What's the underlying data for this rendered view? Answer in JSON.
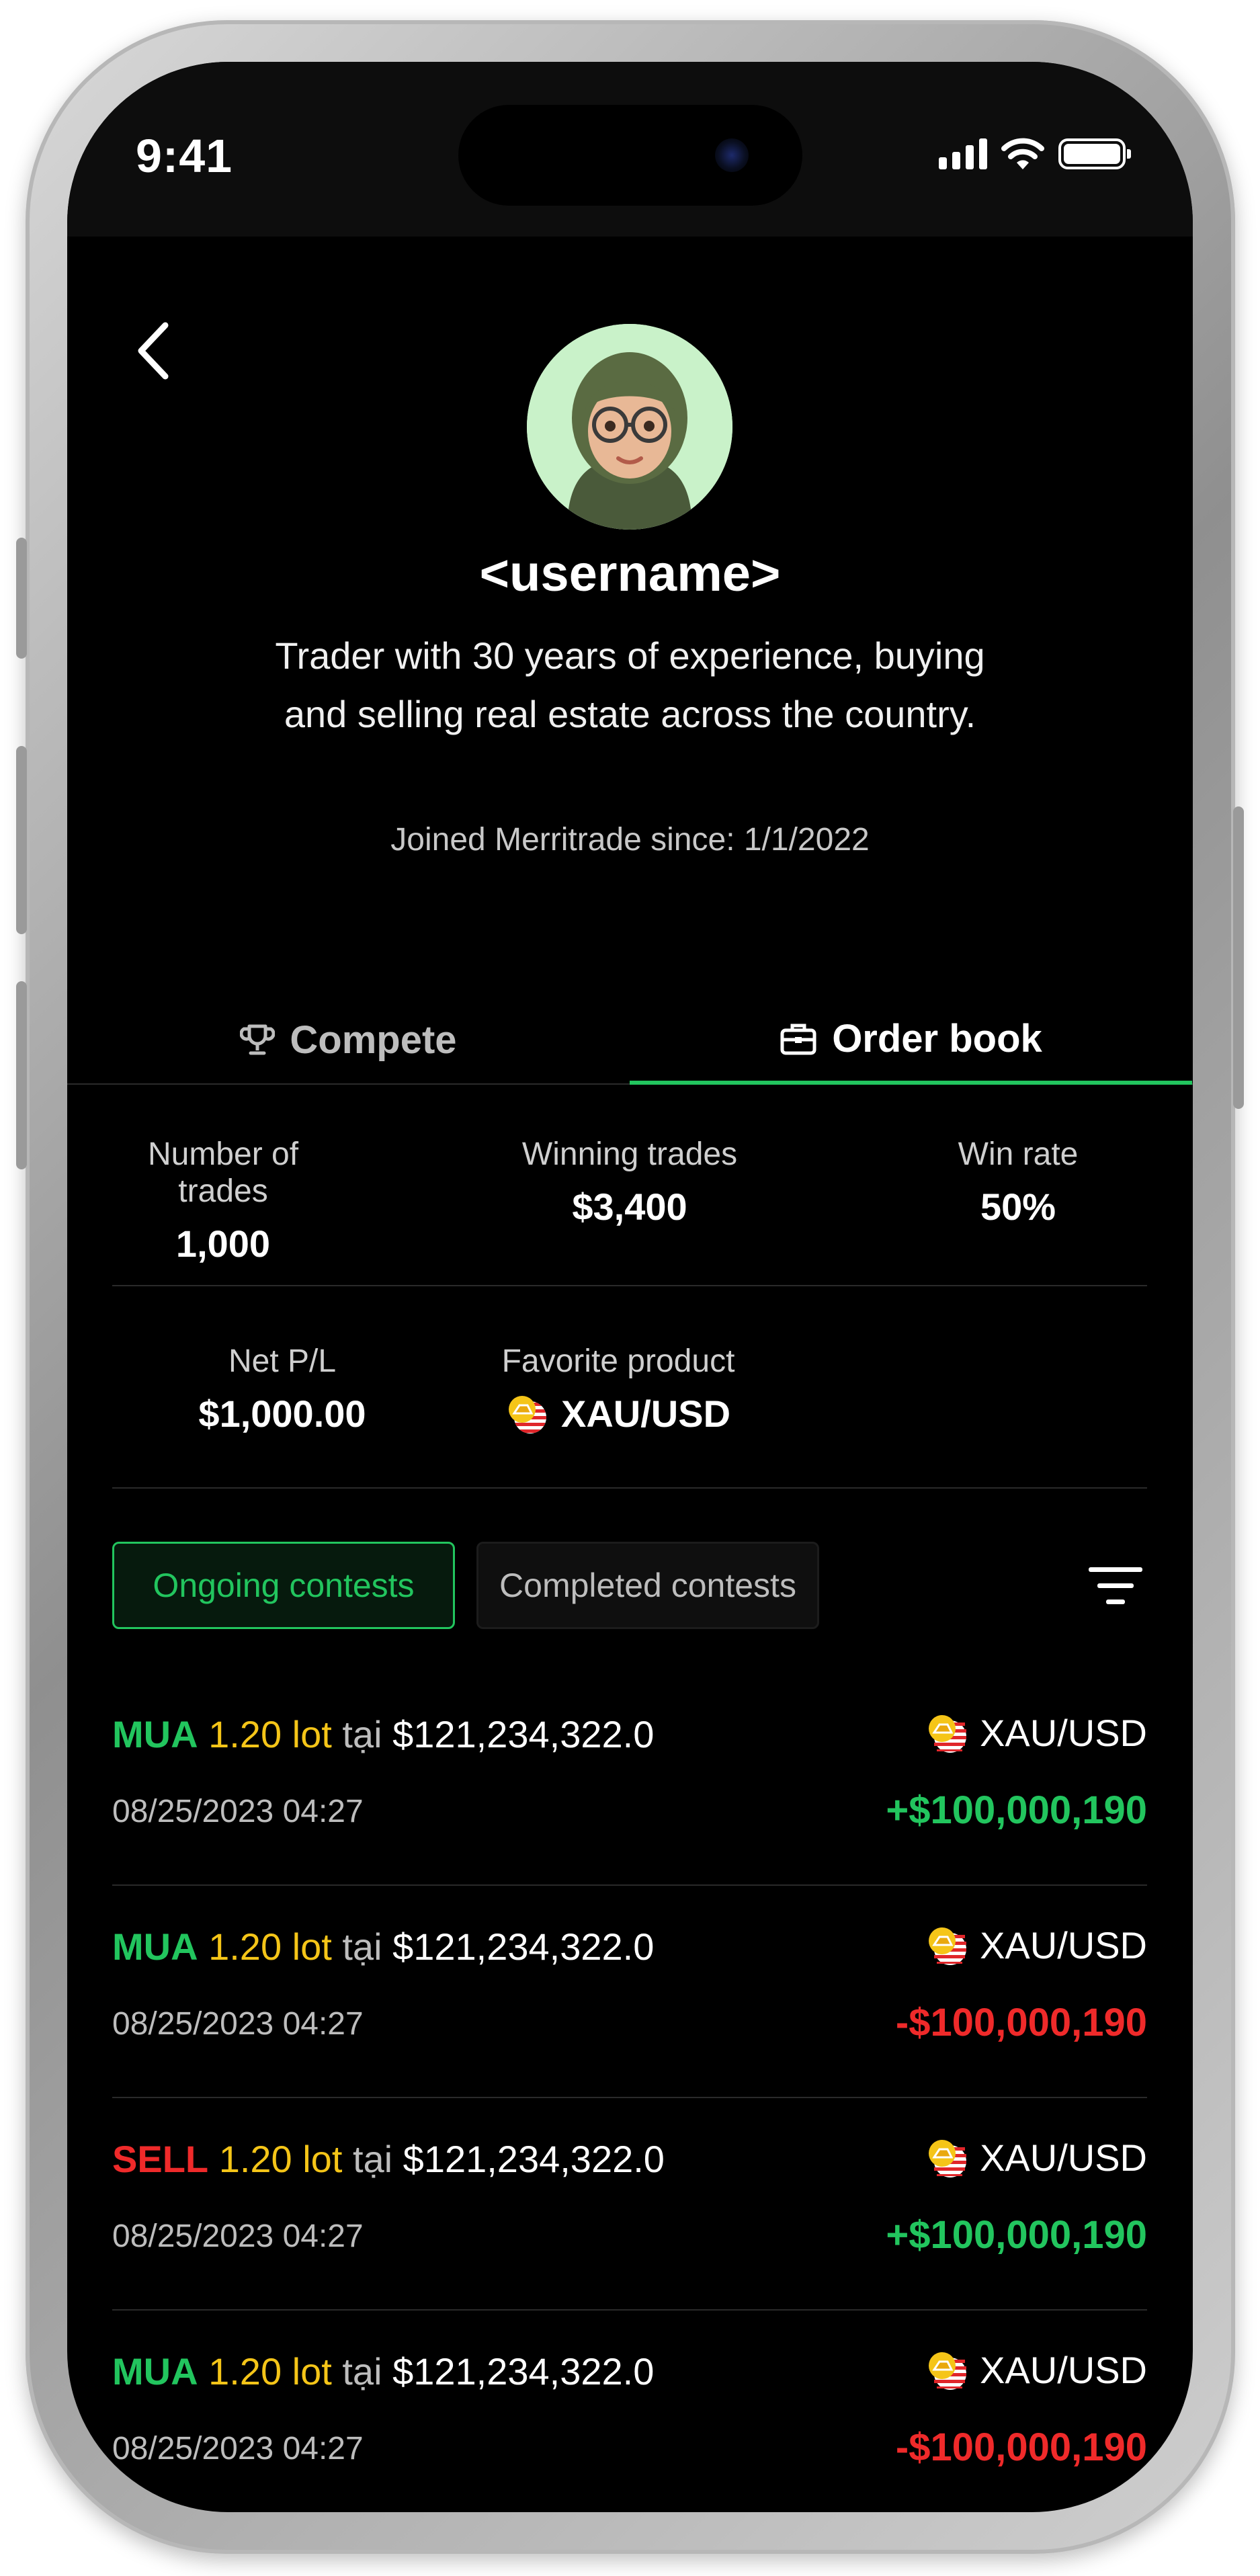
{
  "status_bar": {
    "time": "9:41"
  },
  "profile": {
    "username": "<username>",
    "bio": "Trader with 30 years of experience, buying and selling real estate across the country.",
    "joined": "Joined Merritrade since: 1/1/2022"
  },
  "tabs": [
    {
      "label": "Compete",
      "icon": "trophy-icon",
      "active": false
    },
    {
      "label": "Order book",
      "icon": "briefcase-icon",
      "active": true
    }
  ],
  "stats": {
    "trades_label": "Number of trades",
    "trades_value": "1,000",
    "winning_label": "Winning trades",
    "winning_value": "$3,400",
    "winrate_label": "Win rate",
    "winrate_value": "50%",
    "netpl_label": "Net P/L",
    "netpl_value": "$1,000.00",
    "fav_label": "Favorite product",
    "fav_value": "XAU/USD"
  },
  "filters": {
    "ongoing": "Ongoing contests",
    "completed": "Completed contests",
    "active": "ongoing"
  },
  "trades": [
    {
      "side": "MUA",
      "lot": "1.20 lot",
      "at": "tại",
      "price": "$121,234,322.0",
      "date": "08/25/2023 04:27",
      "product": "XAU/USD",
      "pl": "+$100,000,190",
      "pl_sign": "positive"
    },
    {
      "side": "MUA",
      "lot": "1.20 lot",
      "at": "tại",
      "price": "$121,234,322.0",
      "date": "08/25/2023 04:27",
      "product": "XAU/USD",
      "pl": "-$100,000,190",
      "pl_sign": "negative"
    },
    {
      "side": "SELL",
      "lot": "1.20 lot",
      "at": "tại",
      "price": "$121,234,322.0",
      "date": "08/25/2023 04:27",
      "product": "XAU/USD",
      "pl": "+$100,000,190",
      "pl_sign": "positive"
    },
    {
      "side": "MUA",
      "lot": "1.20 lot",
      "at": "tại",
      "price": "$121,234,322.0",
      "date": "08/25/2023 04:27",
      "product": "XAU/USD",
      "pl": "-$100,000,190",
      "pl_sign": "negative"
    }
  ],
  "colors": {
    "accent": "#22c55e",
    "negative": "#ef2a2a",
    "lot": "#f5c518",
    "background": "#000000"
  }
}
